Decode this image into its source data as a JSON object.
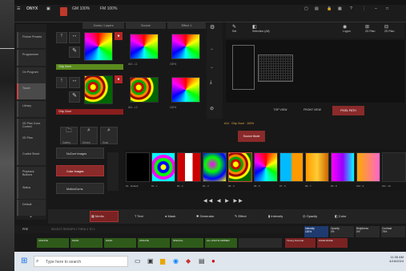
{
  "titlebar": {
    "logo": "ONYX",
    "gm": "GM 100%",
    "fm": "FM 100%"
  },
  "sidebar": {
    "items": [
      {
        "label": "Fixture Presets"
      },
      {
        "label": "Programmer"
      },
      {
        "label": "On Program"
      },
      {
        "label": "Touch"
      },
      {
        "label": "Library"
      },
      {
        "label": "2D Plan Cone Control"
      },
      {
        "label": "2D Plan"
      },
      {
        "label": "Cuelist Sheet"
      },
      {
        "label": "Playback Buttons"
      },
      {
        "label": "Status"
      },
      {
        "label": "Default"
      }
    ]
  },
  "presets": {
    "col_headers": [
      "Zones / Layers",
      "Source",
      "Effect 1"
    ],
    "row1": {
      "bar": "Chip Zone",
      "meta1": "#14 - L1",
      "meta2": "100%"
    },
    "row2": {
      "bar": "Chip Zone",
      "meta1": "#14 - L2",
      "meta2": "100%"
    }
  },
  "folders": {
    "items": [
      "Gallery",
      "Device",
      "Scan"
    ]
  },
  "media_lists": [
    "NuCure Images",
    "Color Images",
    "MotionCorns"
  ],
  "right_panel": {
    "buttons": [
      "Set",
      "Selection (All)",
      "Logon",
      "2D Plan"
    ],
    "views": [
      "TOP VIEW",
      "FRONT VIEW",
      "PIXEL PATH"
    ],
    "source_mode": "Source Mode",
    "status_line": "#14 · Chip Zone · 100%"
  },
  "media_bank": {
    "items": [
      "#1 - Default",
      "#2 - 1",
      "#3 - 2",
      "#4 - 3",
      "#5 - 4",
      "#6 - 5",
      "#7 - 6",
      "#8 - 7",
      "#9 - 8",
      "#10 - 9",
      "#11 - 10"
    ]
  },
  "tabs": [
    "Media",
    "Text",
    "Mask",
    "Generator",
    "Effect",
    "Intensity",
    "Opacity",
    "Color"
  ],
  "bottom": {
    "pre": "PRE",
    "sel_text": "SELECT GROUPS 1 THRU 4 TO 1",
    "faders": [
      "UPDATE",
      "MASK",
      "MASK",
      "UPDATE",
      "SPECIAL",
      "ALL WHITE DIMMER",
      "",
      "Timing Override",
      "FADE MODE"
    ],
    "encoders": [
      {
        "label": "Intensity",
        "value": "100%"
      },
      {
        "label": "Opacity",
        "value": "0%"
      },
      {
        "label": "Brightness",
        "value": "0%"
      },
      {
        "label": "Contrast",
        "value": "75%"
      }
    ]
  },
  "taskbar": {
    "search_placeholder": "Type here to search",
    "time": "11:35 AM",
    "date": "4/16/2024"
  }
}
